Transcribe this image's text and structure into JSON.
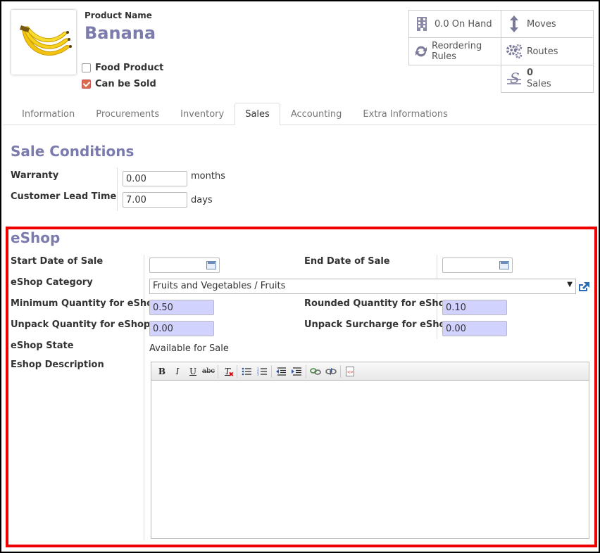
{
  "header": {
    "product_name_label": "Product Name",
    "product_name": "Banana",
    "food_product_label": "Food Product",
    "food_product_checked": false,
    "can_be_sold_label": "Can be Sold",
    "can_be_sold_checked": true
  },
  "smart_buttons": {
    "on_hand": "0.0 On Hand",
    "moves": "Moves",
    "reordering_rules": "Reordering Rules",
    "routes": "Routes",
    "sales_count": "0",
    "sales_label": "Sales"
  },
  "tabs": [
    "Information",
    "Procurements",
    "Inventory",
    "Sales",
    "Accounting",
    "Extra Informations"
  ],
  "active_tab": "Sales",
  "sale_conditions": {
    "title": "Sale Conditions",
    "warranty_label": "Warranty",
    "warranty_value": "0.00",
    "warranty_unit": "months",
    "lead_time_label": "Customer Lead Time",
    "lead_time_value": "7.00",
    "lead_time_unit": "days"
  },
  "eshop": {
    "title": "eShop",
    "start_date_label": "Start Date of Sale",
    "start_date_value": "",
    "end_date_label": "End Date of Sale",
    "end_date_value": "",
    "category_label": "eShop Category",
    "category_value": "Fruits and Vegetables / Fruits",
    "min_qty_label": "Minimum Quantity for eShop",
    "min_qty_value": "0.50",
    "rounded_qty_label": "Rounded Quantity for eShop",
    "rounded_qty_value": "0.10",
    "unpack_qty_label": "Unpack Quantity for eShop",
    "unpack_qty_value": "0.00",
    "unpack_surcharge_label": "Unpack Surcharge for eShop",
    "unpack_surcharge_value": "0.00",
    "state_label": "eShop State",
    "state_value": "Available for Sale",
    "description_label": "Eshop Description",
    "description_value": ""
  },
  "editor_toolbar": {
    "bold": "B",
    "italic": "I",
    "underline": "U",
    "strike": "abc",
    "clear_format": "T"
  },
  "colors": {
    "title": "#7c7bad",
    "required_field": "#d2d2ff",
    "highlight_border": "#ee0000",
    "checkbox_checked": "#d96b49"
  }
}
